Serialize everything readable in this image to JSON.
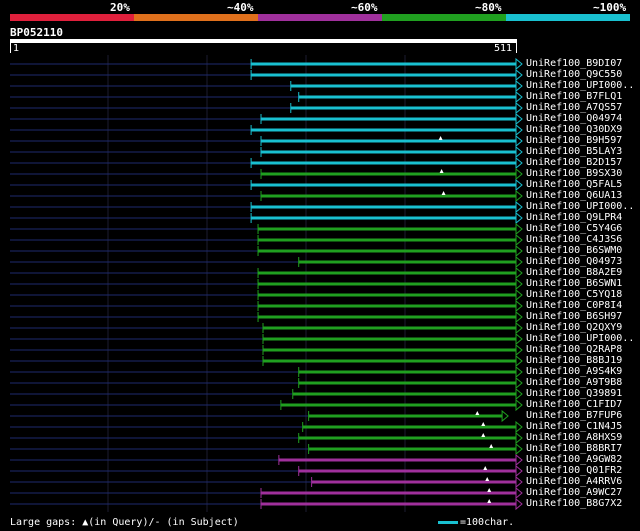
{
  "legend": {
    "segments": [
      {
        "label": "20%",
        "color": "#e0203c"
      },
      {
        "label": "~40%",
        "color": "#e0701c"
      },
      {
        "label": "~60%",
        "color": "#a0309c"
      },
      {
        "label": "~80%",
        "color": "#20a020"
      },
      {
        "label": "~100%",
        "color": "#19c0d0"
      }
    ]
  },
  "query": {
    "title": "BP052110",
    "start": "1",
    "end": "511",
    "length": 511
  },
  "hits": [
    {
      "name": "UniRef100_B9DI07",
      "start": 244,
      "end": 511,
      "color": "#19c0d0",
      "marks": [],
      "seq": "start"
    },
    {
      "name": "UniRef100_Q9C550",
      "start": 244,
      "end": 511,
      "color": "#19c0d0",
      "marks": [],
      "seq": "start"
    },
    {
      "name": "UniRef100_UPI000..",
      "start": 284,
      "end": 511,
      "color": "#19c0d0",
      "marks": []
    },
    {
      "name": "UniRef100_B7FLQ1",
      "start": 292,
      "end": 511,
      "color": "#19c0d0",
      "marks": []
    },
    {
      "name": "UniRef100_A7QS57",
      "start": 284,
      "end": 511,
      "color": "#19c0d0",
      "marks": []
    },
    {
      "name": "UniRef100_Q04974",
      "start": 254,
      "end": 511,
      "color": "#19c0d0",
      "marks": []
    },
    {
      "name": "UniRef100_Q30DX9",
      "start": 244,
      "end": 511,
      "color": "#19c0d0",
      "marks": []
    },
    {
      "name": "UniRef100_B9H597",
      "start": 254,
      "end": 511,
      "color": "#19c0d0",
      "marks": [
        435
      ]
    },
    {
      "name": "UniRef100_B5LAY3",
      "start": 254,
      "end": 511,
      "color": "#19c0d0",
      "marks": []
    },
    {
      "name": "UniRef100_B2D157",
      "start": 244,
      "end": 511,
      "color": "#19c0d0",
      "marks": []
    },
    {
      "name": "UniRef100_B9SX30",
      "start": 254,
      "end": 511,
      "color": "#20a020",
      "marks": [
        436
      ]
    },
    {
      "name": "UniRef100_Q5FAL5",
      "start": 244,
      "end": 511,
      "color": "#19c0d0",
      "marks": []
    },
    {
      "name": "UniRef100_Q6UA13",
      "start": 254,
      "end": 511,
      "color": "#20a020",
      "marks": [
        438
      ]
    },
    {
      "name": "UniRef100_UPI000..",
      "start": 244,
      "end": 511,
      "color": "#19c0d0",
      "marks": []
    },
    {
      "name": "UniRef100_Q9LPR4",
      "start": 244,
      "end": 511,
      "color": "#19c0d0",
      "marks": []
    },
    {
      "name": "UniRef100_C5Y4G6",
      "start": 251,
      "end": 511,
      "color": "#20a020",
      "marks": []
    },
    {
      "name": "UniRef100_C4J3S6",
      "start": 251,
      "end": 511,
      "color": "#20a020",
      "marks": []
    },
    {
      "name": "UniRef100_B6SWM0",
      "start": 251,
      "end": 511,
      "color": "#20a020",
      "marks": []
    },
    {
      "name": "UniRef100_Q04973",
      "start": 292,
      "end": 511,
      "color": "#20a020",
      "marks": []
    },
    {
      "name": "UniRef100_B8A2E9",
      "start": 251,
      "end": 511,
      "color": "#20a020",
      "marks": []
    },
    {
      "name": "UniRef100_B6SWN1",
      "start": 251,
      "end": 511,
      "color": "#20a020",
      "marks": []
    },
    {
      "name": "UniRef100_C5YQ18",
      "start": 251,
      "end": 511,
      "color": "#20a020",
      "marks": []
    },
    {
      "name": "UniRef100_C0P8I4",
      "start": 251,
      "end": 511,
      "color": "#20a020",
      "marks": []
    },
    {
      "name": "UniRef100_B6SH97",
      "start": 251,
      "end": 511,
      "color": "#20a020",
      "marks": []
    },
    {
      "name": "UniRef100_Q2QXY9",
      "start": 256,
      "end": 511,
      "color": "#20a020",
      "marks": []
    },
    {
      "name": "UniRef100_UPI000..",
      "start": 256,
      "end": 511,
      "color": "#20a020",
      "marks": []
    },
    {
      "name": "UniRef100_Q2RAP8",
      "start": 256,
      "end": 511,
      "color": "#20a020",
      "marks": []
    },
    {
      "name": "UniRef100_B8BJ19",
      "start": 256,
      "end": 511,
      "color": "#20a020",
      "marks": []
    },
    {
      "name": "UniRef100_A9S4K9",
      "start": 292,
      "end": 511,
      "color": "#20a020",
      "marks": []
    },
    {
      "name": "UniRef100_A9T9B8",
      "start": 292,
      "end": 511,
      "color": "#20a020",
      "marks": []
    },
    {
      "name": "UniRef100_Q39891",
      "start": 286,
      "end": 511,
      "color": "#20a020",
      "marks": []
    },
    {
      "name": "UniRef100_C1FID7",
      "start": 274,
      "end": 511,
      "color": "#20a020",
      "marks": []
    },
    {
      "name": "UniRef100_B7FUP6",
      "start": 302,
      "end": 497,
      "color": "#20a020",
      "marks": [
        472
      ]
    },
    {
      "name": "UniRef100_C1N4J5",
      "start": 296,
      "end": 511,
      "color": "#20a020",
      "marks": [
        478
      ]
    },
    {
      "name": "UniRef100_A8HXS9",
      "start": 292,
      "end": 511,
      "color": "#20a020",
      "marks": [
        478
      ]
    },
    {
      "name": "UniRef100_B8BRI7",
      "start": 302,
      "end": 511,
      "color": "#20a020",
      "marks": [
        486
      ]
    },
    {
      "name": "UniRef100_A9GW82",
      "start": 272,
      "end": 511,
      "color": "#a0309c",
      "marks": []
    },
    {
      "name": "UniRef100_Q01FR2",
      "start": 292,
      "end": 511,
      "color": "#a0309c",
      "marks": [
        480
      ]
    },
    {
      "name": "UniRef100_A4RRV6",
      "start": 305,
      "end": 511,
      "color": "#a0309c",
      "marks": [
        482
      ]
    },
    {
      "name": "UniRef100_A9WC27",
      "start": 254,
      "end": 511,
      "color": "#a0309c",
      "marks": [
        484
      ]
    },
    {
      "name": "UniRef100_B8G7X2",
      "start": 254,
      "end": 511,
      "color": "#a0309c",
      "marks": [
        484
      ]
    }
  ],
  "footer": {
    "text": "Large gaps: ▲(in Query)/- (in Subject)",
    "scale_label": "=100char."
  }
}
